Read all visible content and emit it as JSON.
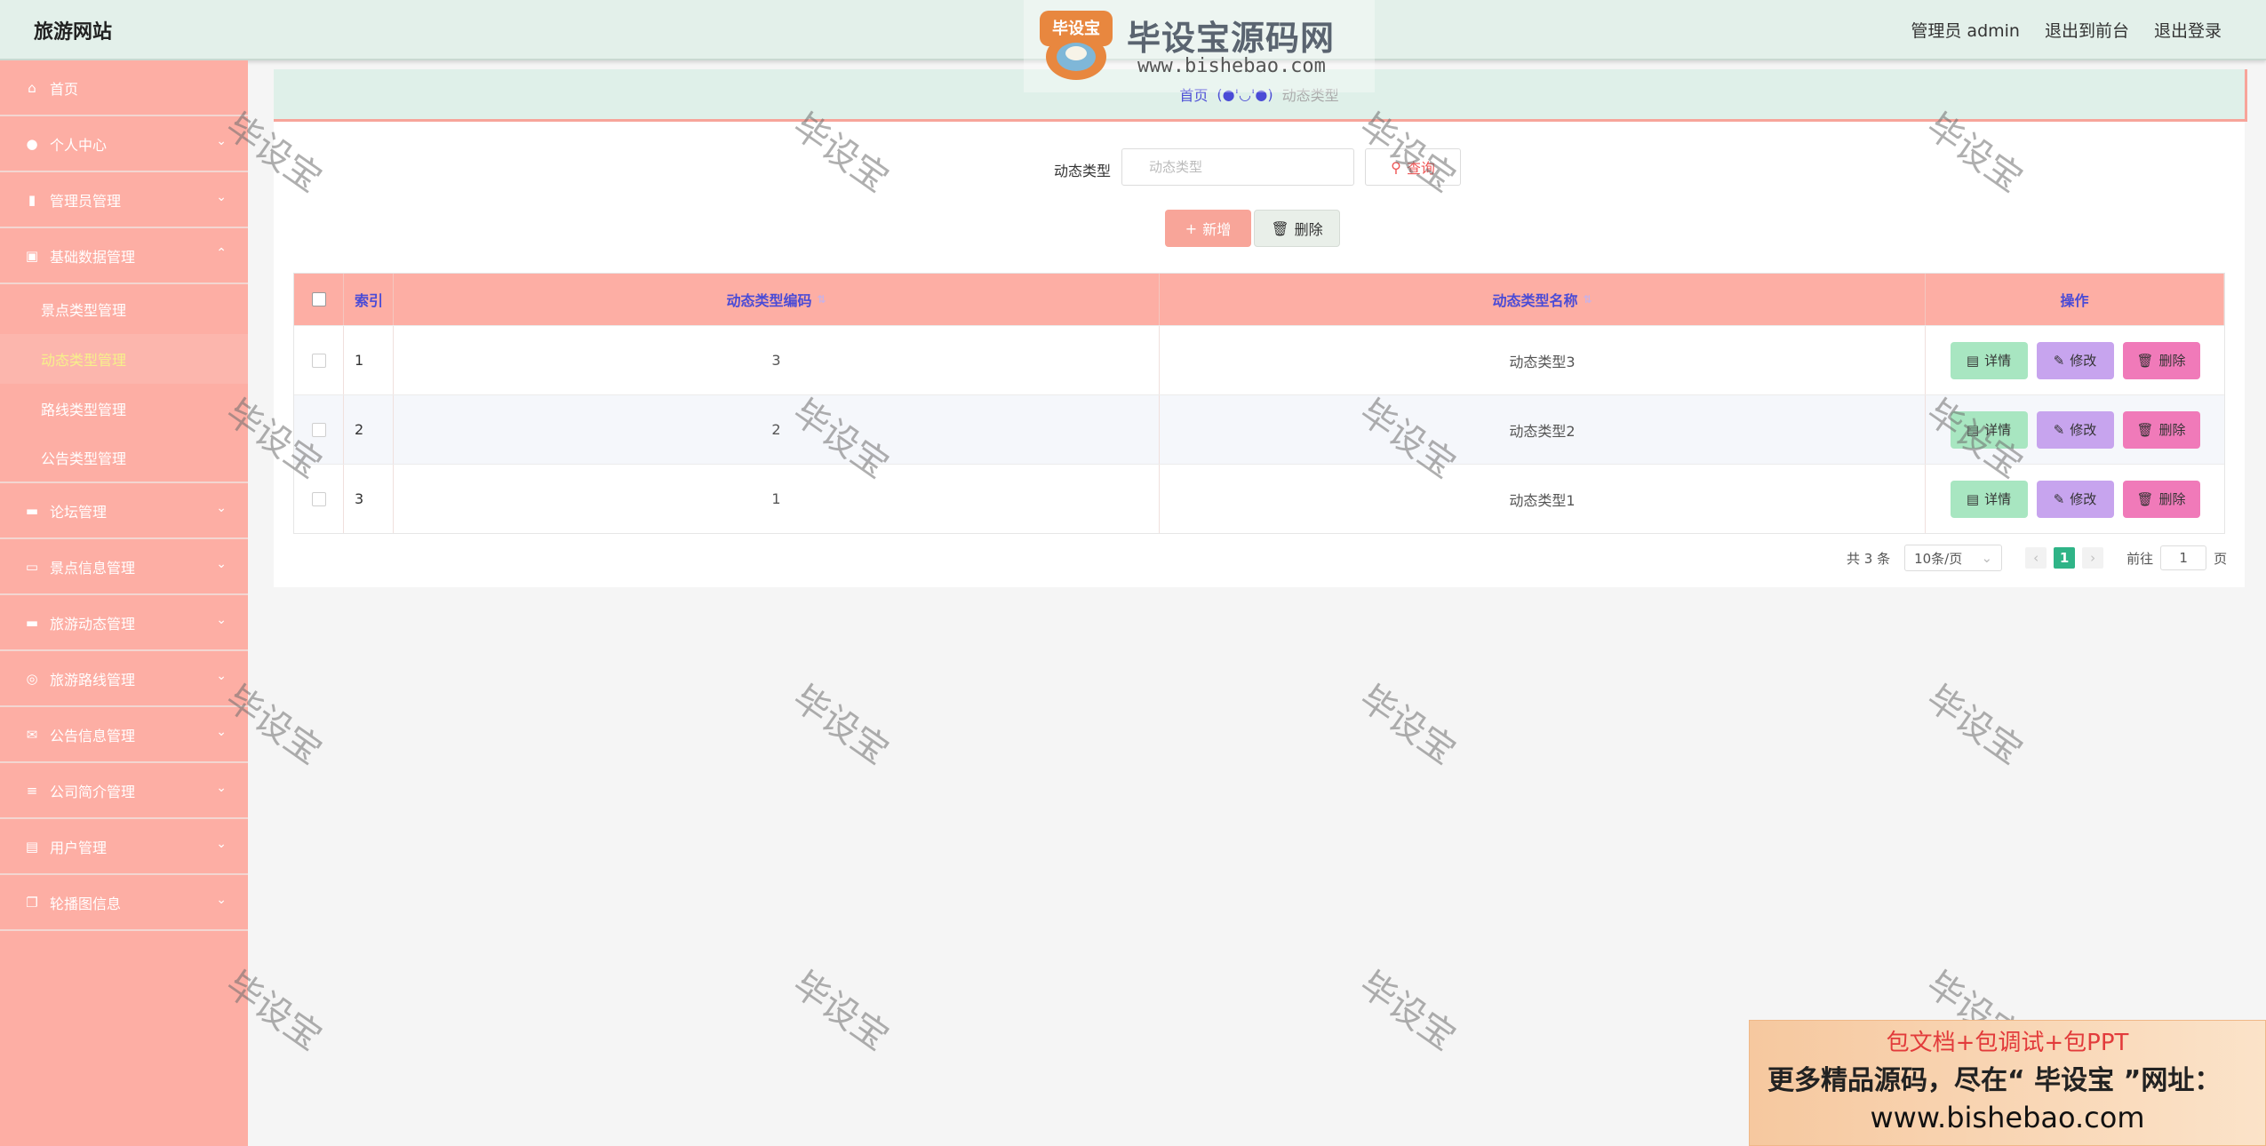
{
  "header": {
    "site_title": "旅游网站",
    "user_label": "管理员 admin",
    "to_front": "退出到前台",
    "logout": "退出登录"
  },
  "logo": {
    "badge_text": "毕设宝",
    "title": "毕设宝源码网",
    "url": "www.bishebao.com"
  },
  "sidebar": {
    "items": [
      {
        "label": "首页",
        "icon": "home-icon"
      },
      {
        "label": "个人中心",
        "icon": "user-icon"
      },
      {
        "label": "管理员管理",
        "icon": "badge-icon"
      },
      {
        "label": "基础数据管理",
        "icon": "chart-icon"
      },
      {
        "label": "论坛管理",
        "icon": "monitor-icon"
      },
      {
        "label": "景点信息管理",
        "icon": "chat-icon"
      },
      {
        "label": "旅游动态管理",
        "icon": "laptop-icon"
      },
      {
        "label": "旅游路线管理",
        "icon": "compass-icon"
      },
      {
        "label": "公告信息管理",
        "icon": "mail-icon"
      },
      {
        "label": "公司简介管理",
        "icon": "list-icon"
      },
      {
        "label": "用户管理",
        "icon": "clipboard-icon"
      },
      {
        "label": "轮播图信息",
        "icon": "copy-icon"
      }
    ],
    "sub_items": [
      {
        "label": "景点类型管理"
      },
      {
        "label": "动态类型管理"
      },
      {
        "label": "路线类型管理"
      },
      {
        "label": "公告类型管理"
      }
    ]
  },
  "breadcrumb": {
    "home": "首页",
    "separator": "(●'◡'●)",
    "current": "动态类型"
  },
  "search": {
    "label": "动态类型",
    "placeholder": "动态类型",
    "button": "查询"
  },
  "actions": {
    "add": "新增",
    "delete": "删除"
  },
  "table": {
    "columns": [
      "索引",
      "动态类型编码",
      "动态类型名称",
      "操作"
    ],
    "rows": [
      {
        "index": "1",
        "code": "3",
        "name": "动态类型3"
      },
      {
        "index": "2",
        "code": "2",
        "name": "动态类型2"
      },
      {
        "index": "3",
        "code": "1",
        "name": "动态类型1"
      }
    ],
    "row_actions": {
      "detail": "详情",
      "edit": "修改",
      "delete": "删除"
    }
  },
  "pagination": {
    "total": "共 3 条",
    "page_size": "10条/页",
    "current_page": "1",
    "goto_label": "前往",
    "goto_value": "1",
    "page_suffix": "页"
  },
  "watermark": "毕设宝",
  "ad": {
    "line1": "包文档+包调试+包PPT",
    "line2": "更多精品源码，尽在“ 毕设宝 ”网址：",
    "line3": "www.bishebao.com"
  },
  "colors": {
    "sidebar": "#fdaea4",
    "header": "#e3f0ea",
    "accent_blue": "#4a4bd6",
    "pager_active": "#2fb487",
    "detail_btn": "#a8e6c1",
    "edit_btn": "#c7a4ee",
    "delete_btn": "#f07ab9"
  }
}
